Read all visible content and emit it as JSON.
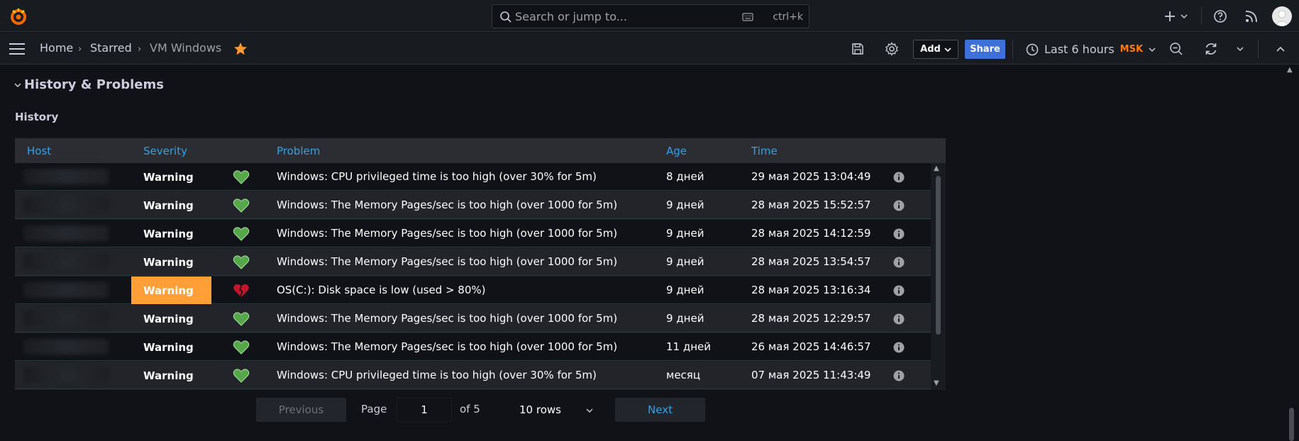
{
  "search": {
    "placeholder": "Search or jump to...",
    "shortcut": "ctrl+k"
  },
  "breadcrumb": {
    "home": "Home",
    "starred": "Starred",
    "current": "VM Windows"
  },
  "toolbar": {
    "add_label": "Add",
    "share_label": "Share",
    "time_range": "Last 6 hours",
    "timezone": "MSK"
  },
  "section": {
    "title": "History & Problems"
  },
  "panel": {
    "title": "History"
  },
  "table": {
    "columns": {
      "host": "Host",
      "severity": "Severity",
      "problem": "Problem",
      "age": "Age",
      "time": "Time"
    },
    "rows": [
      {
        "severity": "Warning",
        "status": "resolved",
        "problem": "Windows: CPU privileged time is too high (over 30% for 5m)",
        "age": "8 дней",
        "time": "29 мая 2025 13:04:49"
      },
      {
        "severity": "Warning",
        "status": "resolved",
        "problem": "Windows: The Memory Pages/sec is too high (over 1000 for 5m)",
        "age": "9 дней",
        "time": "28 мая 2025 15:52:57"
      },
      {
        "severity": "Warning",
        "status": "resolved",
        "problem": "Windows: The Memory Pages/sec is too high (over 1000 for 5m)",
        "age": "9 дней",
        "time": "28 мая 2025 14:12:59"
      },
      {
        "severity": "Warning",
        "status": "resolved",
        "problem": "Windows: The Memory Pages/sec is too high (over 1000 for 5m)",
        "age": "9 дней",
        "time": "28 мая 2025 13:54:57"
      },
      {
        "severity": "Warning",
        "status": "problem",
        "problem": "OS(C:): Disk space is low (used > 80%)",
        "age": "9 дней",
        "time": "28 мая 2025 13:16:34"
      },
      {
        "severity": "Warning",
        "status": "resolved",
        "problem": "Windows: The Memory Pages/sec is too high (over 1000 for 5m)",
        "age": "9 дней",
        "time": "28 мая 2025 12:29:57"
      },
      {
        "severity": "Warning",
        "status": "resolved",
        "problem": "Windows: The Memory Pages/sec is too high (over 1000 for 5m)",
        "age": "11 дней",
        "time": "26 мая 2025 14:46:57"
      },
      {
        "severity": "Warning",
        "status": "resolved",
        "problem": "Windows: CPU privileged time is too high (over 30% for 5m)",
        "age": "месяц",
        "time": "07 мая 2025 11:43:49"
      }
    ]
  },
  "pagination": {
    "previous": "Previous",
    "page_label": "Page",
    "page_value": "1",
    "of_label": "of 5",
    "rows_option": "10 rows",
    "next": "Next"
  },
  "colors": {
    "accent": "#33a2e5",
    "warning_highlight": "#ff9f35",
    "share_button": "#3d71d9",
    "heart_ok": "#56a64b",
    "heart_problem": "#c4162a"
  },
  "icons": [
    "grafana-logo-icon",
    "search-icon",
    "keyboard-icon",
    "plus-icon",
    "help-icon",
    "rss-icon",
    "avatar",
    "menu-icon",
    "star-icon",
    "save-icon",
    "gear-icon",
    "clock-icon",
    "zoom-out-icon",
    "refresh-icon",
    "chevron-up-icon",
    "heart-icon",
    "broken-heart-icon",
    "info-icon"
  ]
}
